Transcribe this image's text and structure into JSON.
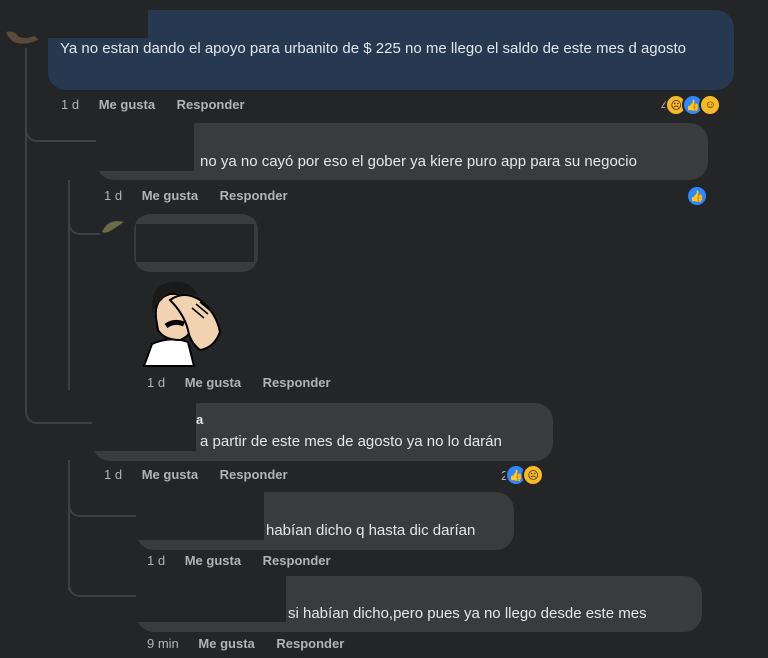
{
  "comments": [
    {
      "text": "Ya no estan dando el apoyo para urbanito de $ 225 no me llego el saldo de este mes d agosto",
      "time": "1 d",
      "like": "Me gusta",
      "reply": "Responder",
      "reaction_count": "4",
      "reactions": [
        "sad-icon",
        "like-icon",
        "haha-icon"
      ]
    },
    {
      "text": "no ya no cayó por eso el gober ya kiere puro app para su negocio",
      "time": "1 d",
      "like": "Me gusta",
      "reply": "Responder",
      "reactions": [
        "like-icon"
      ]
    },
    {
      "text": "",
      "sticker": "facepalm-sticker",
      "time": "1 d",
      "like": "Me gusta",
      "reply": "Responder"
    },
    {
      "name_fragment": "a",
      "text": "a partir de este mes de agosto ya no lo darán",
      "time": "1 d",
      "like": "Me gusta",
      "reply": "Responder",
      "reaction_count": "2",
      "reactions": [
        "like-icon",
        "sad-icon"
      ]
    },
    {
      "text": "habían dicho q hasta dic darían",
      "time": "1 d",
      "like": "Me gusta",
      "reply": "Responder"
    },
    {
      "text": "si habían dicho,pero pues ya no llego desde este mes",
      "time": "9 min",
      "like": "Me gusta",
      "reply": "Responder"
    }
  ],
  "colors": {
    "background": "#242526",
    "bubble": "#3a3b3c",
    "bubble_highlight": "#263951",
    "like_blue": "#2d88ff",
    "emoji_yellow": "#f7b928"
  }
}
